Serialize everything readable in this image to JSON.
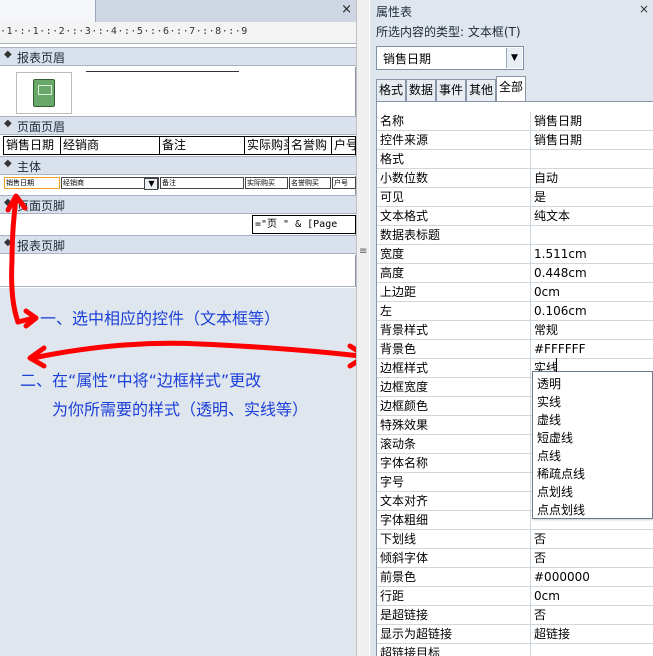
{
  "design": {
    "tab_close": "×",
    "ruler": "·1·:·1·:·2·:·3·:·4·:·5·:·6·:·7·:·8·:·9",
    "report_header_band": "报表页眉",
    "page_header_band": "页面页眉",
    "detail_band": "主体",
    "page_footer_band": "页面页脚",
    "report_footer_band": "报表页脚",
    "header_labels": [
      "销售日期",
      "经销商",
      "备注",
      "实际购买",
      "名誉购",
      "户号"
    ],
    "detail_fields": [
      "销售日期",
      "经销商",
      "备注",
      "实际购买",
      "名誉购买",
      "户号"
    ],
    "page_expr": "=\"页 \" & [Page"
  },
  "annotations": {
    "step1": "一、选中相应的控件（文本框等）",
    "step2_line1": "二、在“属性”中将“边框样式”更改",
    "step2_line2": "为你所需要的样式（透明、实线等）",
    "arrow_color": "#ff0000",
    "text_color": "#1c3fd8"
  },
  "property_sheet": {
    "title": "属性表",
    "close": "×",
    "selection_type": "所选内容的类型: 文本框(T)",
    "object_selector": "销售日期",
    "tabs": [
      "格式",
      "数据",
      "事件",
      "其他",
      "全部"
    ],
    "active_tab": "全部",
    "rows": [
      {
        "k": "名称",
        "v": "销售日期"
      },
      {
        "k": "控件来源",
        "v": "销售日期"
      },
      {
        "k": "格式",
        "v": ""
      },
      {
        "k": "小数位数",
        "v": "自动"
      },
      {
        "k": "可见",
        "v": "是"
      },
      {
        "k": "文本格式",
        "v": "纯文本"
      },
      {
        "k": "数据表标题",
        "v": ""
      },
      {
        "k": "宽度",
        "v": "1.511cm"
      },
      {
        "k": "高度",
        "v": "0.448cm"
      },
      {
        "k": "上边距",
        "v": "0cm"
      },
      {
        "k": "左",
        "v": "0.106cm"
      },
      {
        "k": "背景样式",
        "v": "常规"
      },
      {
        "k": "背景色",
        "v": "#FFFFFF"
      },
      {
        "k": "边框样式",
        "v": "实线"
      },
      {
        "k": "边框宽度",
        "v": ""
      },
      {
        "k": "边框颜色",
        "v": ""
      },
      {
        "k": "特殊效果",
        "v": ""
      },
      {
        "k": "滚动条",
        "v": ""
      },
      {
        "k": "字体名称",
        "v": ""
      },
      {
        "k": "字号",
        "v": ""
      },
      {
        "k": "文本对齐",
        "v": ""
      },
      {
        "k": "字体粗细",
        "v": ""
      },
      {
        "k": "下划线",
        "v": "否"
      },
      {
        "k": "倾斜字体",
        "v": "否"
      },
      {
        "k": "前景色",
        "v": "#000000"
      },
      {
        "k": "行距",
        "v": "0cm"
      },
      {
        "k": "是超链接",
        "v": "否"
      },
      {
        "k": "显示为超链接",
        "v": "超链接"
      },
      {
        "k": "超链接目标",
        "v": ""
      }
    ],
    "border_style_options": [
      "透明",
      "实线",
      "虚线",
      "短虚线",
      "点线",
      "稀疏点线",
      "点划线",
      "点点划线"
    ]
  }
}
